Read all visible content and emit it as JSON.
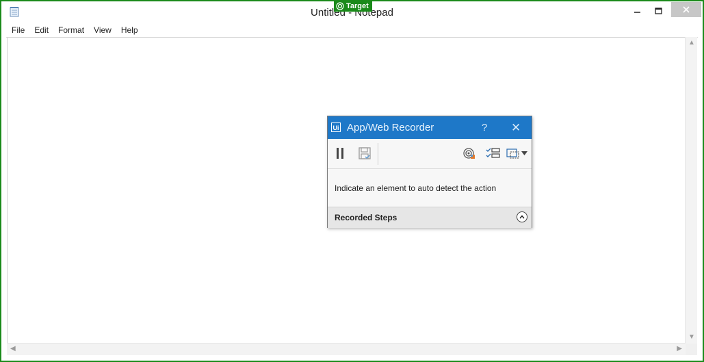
{
  "notepad": {
    "title": "Untitled - Notepad",
    "menu": [
      "File",
      "Edit",
      "Format",
      "View",
      "Help"
    ],
    "content": ""
  },
  "target_tag": {
    "label": "Target"
  },
  "recorder": {
    "title": "App/Web Recorder",
    "help_label": "?",
    "close_label": "✕",
    "logo": "Ui",
    "message": "Indicate an element to auto detect the action",
    "recorded_steps_label": "Recorded Steps"
  },
  "colors": {
    "recorder_titlebar": "#1e78c8",
    "window_border": "#1a8a1a",
    "target_tag": "#1a8a1a"
  }
}
